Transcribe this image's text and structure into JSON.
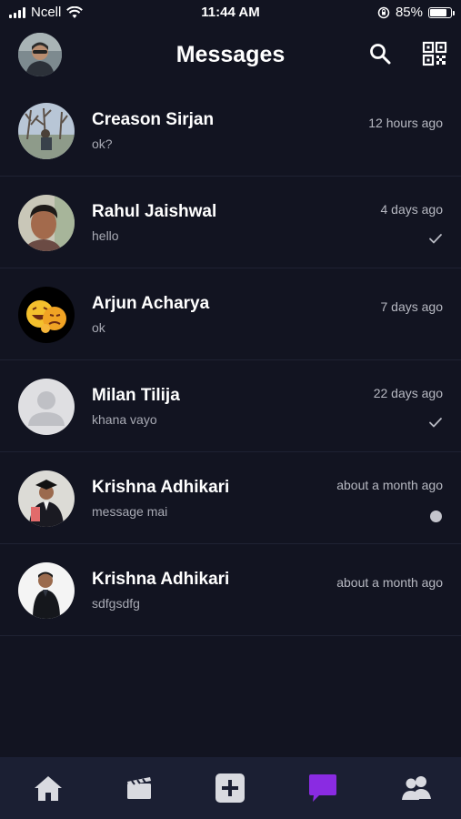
{
  "status_bar": {
    "carrier": "Ncell",
    "time": "11:44 AM",
    "battery": "85%",
    "battery_level": 0.85
  },
  "header": {
    "title": "Messages"
  },
  "conversations": [
    {
      "name": "Creason Sirjan",
      "message": "ok?",
      "time": "12 hours ago",
      "status": "none",
      "avatar": "photo-outdoor"
    },
    {
      "name": "Rahul Jaishwal",
      "message": "hello",
      "time": "4 days ago",
      "status": "sent-check",
      "avatar": "photo-face"
    },
    {
      "name": "Arjun Acharya",
      "message": "ok",
      "time": "7 days ago",
      "status": "none",
      "avatar": "emoji-masks"
    },
    {
      "name": "Milan Tilija",
      "message": "khana vayo",
      "time": "22 days ago",
      "status": "sent-check",
      "avatar": "default-avatar"
    },
    {
      "name": "Krishna Adhikari",
      "message": "message mai",
      "time": "about a month ago",
      "status": "unread-dot",
      "avatar": "photo-graduation"
    },
    {
      "name": "Krishna Adhikari",
      "message": "sdfgsdfg",
      "time": "about a month ago",
      "status": "none",
      "avatar": "photo-portrait"
    }
  ],
  "bottom_nav": {
    "items": [
      "home-icon",
      "reels-icon",
      "create-post-icon",
      "messages-icon",
      "friends-icon"
    ],
    "active": "messages-icon",
    "active_color": "#8a2be2",
    "inactive_color": "#d9dae0"
  }
}
